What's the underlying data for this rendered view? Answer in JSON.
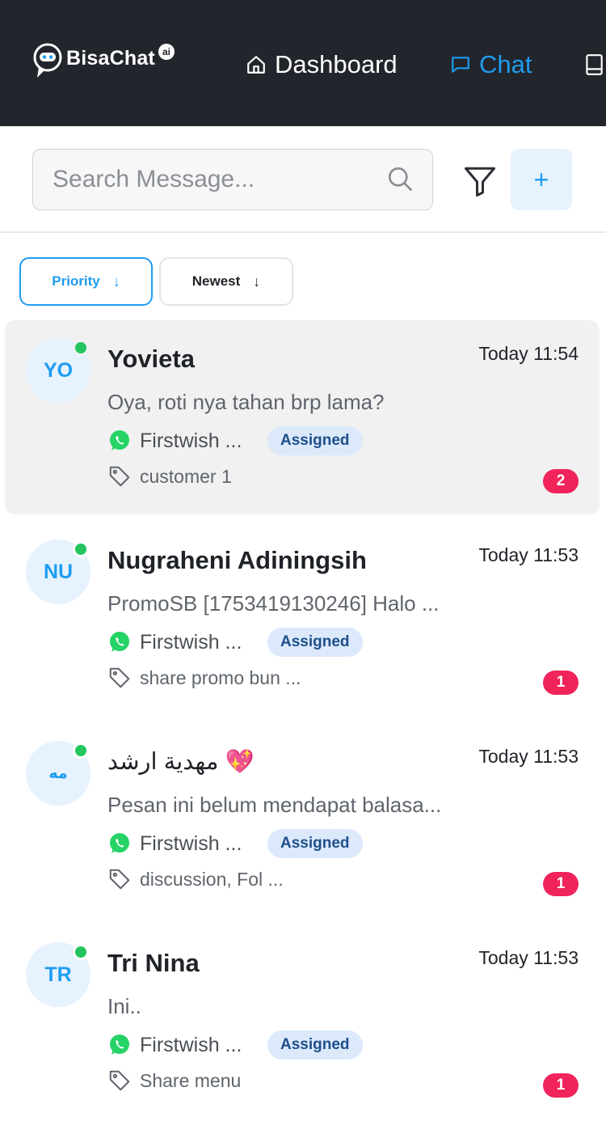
{
  "header": {
    "brand": "BisaChat",
    "brand_badge": "ai",
    "nav": [
      {
        "label": "Dashboard",
        "icon": "home-icon"
      },
      {
        "label": "Chat",
        "icon": "chat-icon",
        "active": true
      },
      {
        "label": "",
        "icon": "book-icon"
      }
    ]
  },
  "search": {
    "placeholder": "Search Message...",
    "value": ""
  },
  "toolbar": {
    "filter_icon": "filter-icon",
    "add_label": "+"
  },
  "sort": {
    "priority_label": "Priority",
    "newest_label": "Newest"
  },
  "colors": {
    "accent": "#1e9cf0",
    "topbar": "#22252b",
    "online": "#22c55e",
    "unread": "#f0245a",
    "assigned_bg": "#dbe9fb"
  },
  "conversations": [
    {
      "initials": "YO",
      "name": "Yovieta",
      "time": "Today 11:54",
      "preview": "Oya, roti nya tahan brp lama?",
      "channel": "Firstwish ...",
      "status": "Assigned",
      "tags": "customer 1",
      "unread": "2",
      "active": true
    },
    {
      "initials": "NU",
      "name": "Nugraheni Adiningsih",
      "time": "Today 11:53",
      "preview": "PromoSB [1753419130246] Halo ...",
      "channel": "Firstwish ...",
      "status": "Assigned",
      "tags": "share promo bun ...",
      "unread": "1"
    },
    {
      "initials": "مه",
      "name": "مهدية ارشد 💖",
      "time": "Today 11:53",
      "preview": "Pesan ini belum mendapat balasa...",
      "channel": "Firstwish ...",
      "status": "Assigned",
      "tags": "discussion, Fol ...",
      "unread": "1"
    },
    {
      "initials": "TR",
      "name": "Tri Nina",
      "time": "Today 11:53",
      "preview": "Ini..",
      "channel": "Firstwish ...",
      "status": "Assigned",
      "tags": "Share menu",
      "unread": "1"
    }
  ]
}
